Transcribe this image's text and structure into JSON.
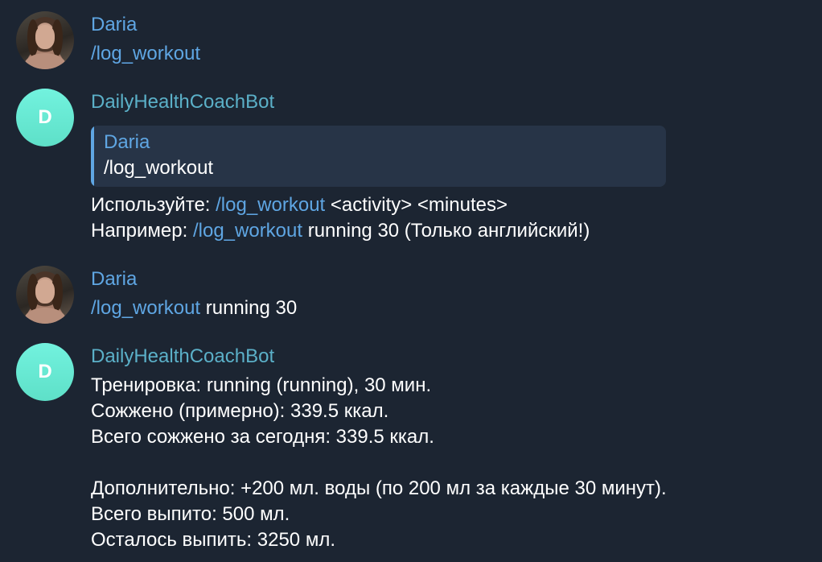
{
  "messages": [
    {
      "sender": "Daria",
      "avatar": "user-photo-avatar",
      "command": "/log_workout"
    },
    {
      "sender": "DailyHealthCoachBot",
      "avatar_letter": "D",
      "reply": {
        "name": "Daria",
        "text": "/log_workout"
      },
      "lines": [
        {
          "prefix": "Используйте: ",
          "command": "/log_workout",
          "suffix": " <activity> <minutes>"
        },
        {
          "prefix": "Например: ",
          "command": "/log_workout",
          "suffix": " running 30 (Только английский!)"
        }
      ]
    },
    {
      "sender": "Daria",
      "avatar": "user-photo-avatar",
      "command": "/log_workout",
      "suffix": " running 30"
    },
    {
      "sender": "DailyHealthCoachBot",
      "avatar_letter": "D",
      "lines": [
        "Тренировка: running (running), 30 мин.",
        "Сожжено (примерно): 339.5 ккал.",
        "Всего сожжено за сегодня: 339.5 ккал.",
        "",
        "Дополнительно: +200 мл. воды (по 200 мл за каждые 30 минут).",
        "Всего выпито: 500 мл.",
        "Осталось выпить: 3250 мл."
      ]
    }
  ],
  "colors": {
    "background": "#1c2532",
    "link": "#5fa6e3",
    "bot_name": "#5bb0c8",
    "bot_avatar": "#72f2de",
    "reply_box": "#273447"
  }
}
